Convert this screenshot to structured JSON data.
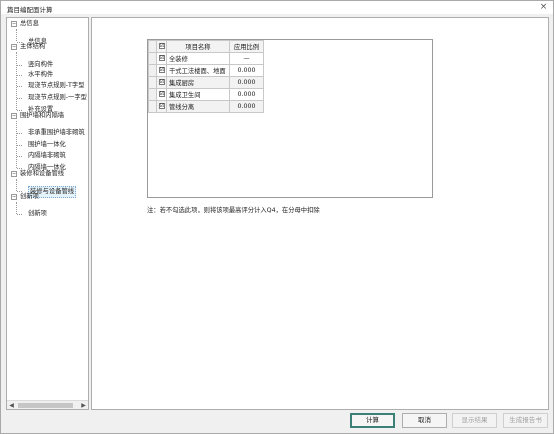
{
  "window": {
    "title": "篇目编配面计算",
    "close_glyph": "×"
  },
  "tree": {
    "groups": [
      {
        "label": "总信息",
        "toggle": "−",
        "children": [
          "总信息"
        ]
      },
      {
        "label": "主体结构",
        "toggle": "−",
        "children": [
          "竖向构件",
          "水平构件",
          "现浇节点规则-T字型",
          "现浇节点规则-一字型",
          "补充设置"
        ]
      },
      {
        "label": "围护墙和内隔墙",
        "toggle": "−",
        "children": [
          "非承重围护墙非砌筑",
          "围护墙一体化",
          "内隔墙非砌筑",
          "内隔墙一体化"
        ]
      },
      {
        "label": "装修和设备管线",
        "toggle": "−",
        "children": [
          "装修与设备管线"
        ]
      },
      {
        "label": "创新项",
        "toggle": "−",
        "children": [
          "创新项"
        ]
      }
    ],
    "selected": "装修与设备管线",
    "scroll_left": "◀",
    "scroll_right": "▶"
  },
  "table": {
    "headers": {
      "check": "☑",
      "name": "项目名称",
      "ratio": "应用比例"
    },
    "rows": [
      {
        "name": "全装修",
        "ratio": "—",
        "checked": "☑"
      },
      {
        "name": "干式工法楼面、地面",
        "ratio": "0.000",
        "checked": "☑"
      },
      {
        "name": "集成厨房",
        "ratio": "0.000",
        "checked": "☑"
      },
      {
        "name": "集成卫生间",
        "ratio": "0.000",
        "checked": "☑"
      },
      {
        "name": "管线分离",
        "ratio": "0.000",
        "checked": "☑"
      }
    ]
  },
  "note": "注：若不勾选此项，则将该项最高评分计入Q4，在分母中扣除",
  "buttons": {
    "calculate": "计算",
    "cancel": "取消",
    "show_result": "显示结果",
    "generate_report": "生成报告书"
  }
}
